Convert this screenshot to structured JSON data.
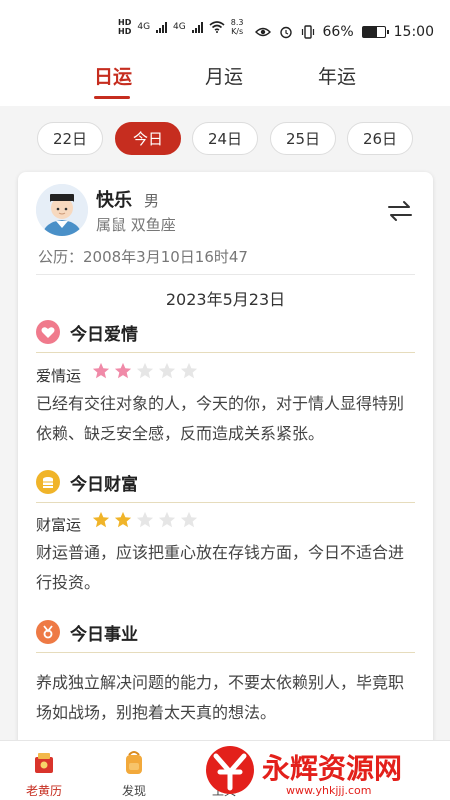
{
  "status_bar": {
    "hd_top": "HD",
    "hd_bottom": "HD",
    "signal1": "4G",
    "signal2": "4G",
    "speed_value": "8.3",
    "speed_unit": "K/s",
    "battery": "66%",
    "time": "15:00"
  },
  "tabs": [
    {
      "label": "日运",
      "active": true
    },
    {
      "label": "月运",
      "active": false
    },
    {
      "label": "年运",
      "active": false
    }
  ],
  "days": [
    {
      "label": "22日",
      "active": false
    },
    {
      "label": "今日",
      "active": true
    },
    {
      "label": "24日",
      "active": false
    },
    {
      "label": "25日",
      "active": false
    },
    {
      "label": "26日",
      "active": false
    }
  ],
  "profile": {
    "name": "快乐",
    "gender": "男",
    "zodiac": "属鼠 双鱼座",
    "birth": "公历：2008年3月10日16时47"
  },
  "date": "2023年5月23日",
  "sections": {
    "love": {
      "title": "今日爱情",
      "label": "爱情运",
      "rating": 2,
      "star_color": "#f08aa8",
      "text": "已经有交往对象的人，今天的你，对于情人显得特别依赖、缺乏安全感，反而造成关系紧张。"
    },
    "wealth": {
      "title": "今日财富",
      "label": "财富运",
      "rating": 2,
      "star_color": "#f0b429",
      "text": "财运普通，应该把重心放在存钱方面，今日不适合进行投资。"
    },
    "career": {
      "title": "今日事业",
      "text": "养成独立解决问题的能力，不要太依赖别人，毕竟职场如战场，别抱着太天真的想法。"
    }
  },
  "bottom_nav": [
    {
      "label": "老黄历",
      "active": true,
      "icon": "almanac-icon"
    },
    {
      "label": "发现",
      "active": false,
      "icon": "backpack-icon"
    },
    {
      "label": "工具",
      "active": false,
      "icon": "tools-icon"
    }
  ],
  "watermark": {
    "brand": "永辉资源网",
    "url": "www.yhkjjj.com"
  },
  "colors": {
    "accent": "#c62d1f"
  }
}
